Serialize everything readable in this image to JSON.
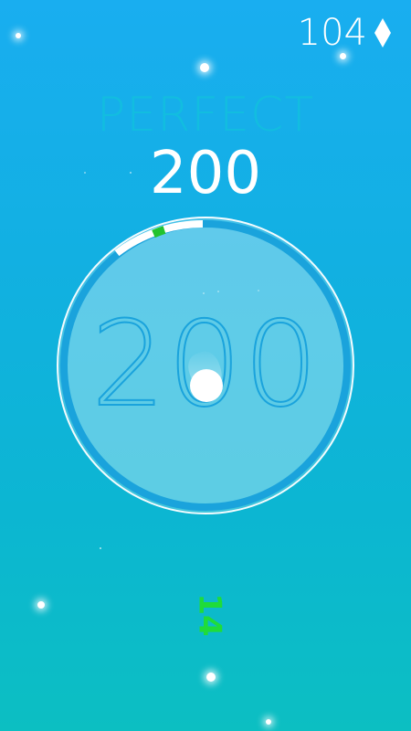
{
  "hud": {
    "gem_count": "104",
    "gem_icon": "diamond-icon"
  },
  "feedback": {
    "rating": "PERFECT",
    "points": "200"
  },
  "dial": {
    "score": "200",
    "ball_icon": "ball-icon",
    "target_zone_color": "#22c32e",
    "ring_color": "#1aa3dc"
  },
  "combo": {
    "count": "14",
    "color": "#1fdc3a"
  },
  "colors": {
    "background_top": "#19aef0",
    "background_bottom": "#0cbfc2",
    "perfect_text": "#12bde0"
  }
}
